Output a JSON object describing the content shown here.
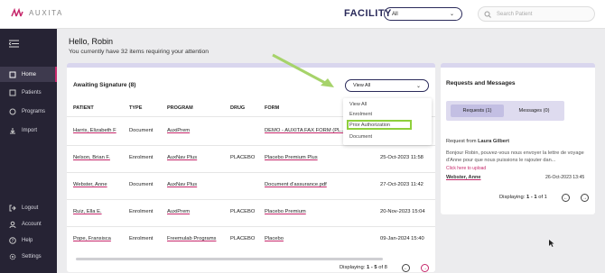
{
  "app": {
    "logo_text": "AUXITA"
  },
  "header": {
    "facility_label": "FACILITY",
    "facility_value": "All",
    "search_placeholder": "Search Patient"
  },
  "sidebar": {
    "items": [
      {
        "label": "Home",
        "icon": "home-icon"
      },
      {
        "label": "Patients",
        "icon": "patients-icon"
      },
      {
        "label": "Programs",
        "icon": "programs-icon"
      },
      {
        "label": "Import",
        "icon": "import-icon"
      },
      {
        "label": "Logout",
        "icon": "logout-icon"
      },
      {
        "label": "Account",
        "icon": "account-icon"
      },
      {
        "label": "Help",
        "icon": "help-icon"
      },
      {
        "label": "Settings",
        "icon": "settings-icon"
      }
    ]
  },
  "main": {
    "greeting": "Hello, Robin",
    "subtitle": "You currently have 32 items requiring your attention"
  },
  "awaiting": {
    "title": "Awaiting Signature (8)",
    "filter_value": "View All",
    "filter_options": [
      "View All",
      "Enrolment",
      "Prior Authorization",
      "Document"
    ],
    "columns": [
      "PATIENT",
      "TYPE",
      "PROGRAM",
      "DRUG",
      "FORM"
    ],
    "rows": [
      {
        "patient": "Harris, Elizabeth F",
        "type": "Document",
        "program": "AuxiPrem",
        "drug": "",
        "form": "DEMO - AUXITA FAX FORM (PL...",
        "date": ""
      },
      {
        "patient": "Nelson, Brian F.",
        "type": "Enrolment",
        "program": "AuxNav Plus",
        "drug": "PLACEBO",
        "form": "Placebo Premium Plus",
        "date": "25-Oct-2023 11:58"
      },
      {
        "patient": "Webster, Anne",
        "type": "Document",
        "program": "AuxNav Plus",
        "drug": "",
        "form": "Document d'assurance.pdf",
        "date": "27-Oct-2023 11:42"
      },
      {
        "patient": "Ruiz, Ella E.",
        "type": "Enrolment",
        "program": "AuxiPrem",
        "drug": "PLACEBO",
        "form": "Placebo Premium",
        "date": "20-Nov-2023 15:04"
      },
      {
        "patient": "Pope, Fransisca",
        "type": "Enrolment",
        "program": "Freemulab Programs",
        "drug": "PLACEBO",
        "form": "Placebo",
        "date": "09-Jan-2024 15:40"
      }
    ],
    "pager_label": "Displaying:",
    "pager_range": "1 - 5",
    "pager_of": "of 8"
  },
  "requests": {
    "title": "Requests and Messages",
    "tab_requests": "Requests (1)",
    "tab_messages": "Messages (0)",
    "request_prefix": "Request from",
    "request_from": "Laura Gilbert",
    "message": "Bonjour Robin, pouvez-vous nous envoyer la lettre de voyage d'Anne pour que nous puissions le rajouter dan...",
    "upload_link": "Click here to upload",
    "patient": "Webster, Anne",
    "date": "26-Oct-2023 13:45",
    "pager_label": "Displaying:",
    "pager_range": "1 - 1",
    "pager_of": "of 1"
  },
  "colors": {
    "sidebar_bg": "#262334",
    "accent": "#c6286b",
    "highlight": "#8fcf3c",
    "panel_header": "#d9d6ee"
  }
}
